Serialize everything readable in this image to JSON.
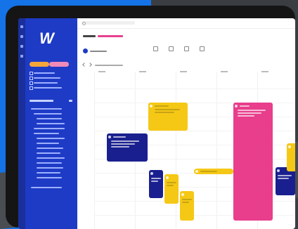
{
  "app": {
    "logo_text": "W"
  },
  "colors": {
    "sidebar": "#1e3bc6",
    "accent_pink": "#e8418f",
    "event_yellow": "#f5c816",
    "event_navy": "#1a1f8f",
    "event_pink": "#e83e8c",
    "backdrop_blue": "#1473e6"
  },
  "icons": [
    "menu-icon",
    "search-icon",
    "calendar-icon",
    "user-icon",
    "filter-icon",
    "settings-icon"
  ]
}
